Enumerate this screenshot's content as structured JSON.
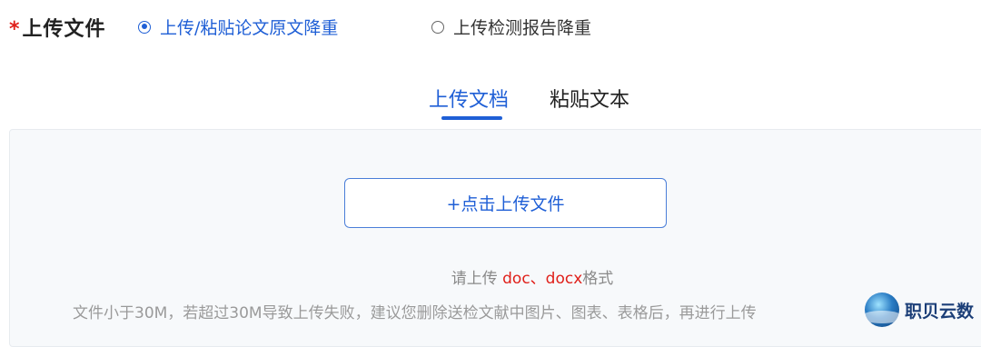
{
  "field": {
    "required_mark": "*",
    "label": "上传文件"
  },
  "mode_options": [
    {
      "label": "上传/粘贴论文原文降重",
      "checked": true
    },
    {
      "label": "上传检测报告降重",
      "checked": false
    }
  ],
  "tabs": [
    {
      "label": "上传文档",
      "active": true
    },
    {
      "label": "粘贴文本",
      "active": false
    }
  ],
  "upload": {
    "button_label": "+点击上传文件",
    "format_prefix": "请上传 ",
    "format_doc": "doc",
    "format_sep": "、",
    "format_docx": "docx",
    "format_suffix": "格式",
    "size_hint": "文件小于30M，若超过30M导致上传失败，建议您删除送检文献中图片、图表、表格后，再进行上传"
  },
  "watermark": {
    "text": "职贝云数"
  },
  "colors": {
    "accent": "#1f5fd6",
    "required": "#e0201a",
    "panel_bg": "#f7f9fb"
  }
}
